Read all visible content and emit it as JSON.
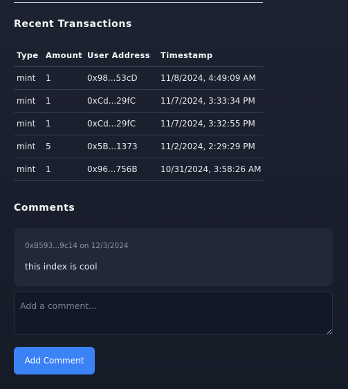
{
  "transactions": {
    "title": "Recent Transactions",
    "columns": [
      "Type",
      "Amount",
      "User Address",
      "Timestamp"
    ],
    "rows": [
      [
        "mint",
        "1",
        "0x98...53cD",
        "11/8/2024, 4:49:09 AM"
      ],
      [
        "mint",
        "1",
        "0xCd...29fC",
        "11/7/2024, 3:33:34 PM"
      ],
      [
        "mint",
        "1",
        "0xCd...29fC",
        "11/7/2024, 3:32:55 PM"
      ],
      [
        "mint",
        "5",
        "0x5B...1373",
        "11/2/2024, 2:29:29 PM"
      ],
      [
        "mint",
        "1",
        "0x96...756B",
        "10/31/2024, 3:58:26 AM"
      ]
    ]
  },
  "comments": {
    "title": "Comments",
    "items": [
      {
        "meta": "0xB593...9c14 on 12/3/2024",
        "text": "this index is cool"
      }
    ],
    "input_placeholder": "Add a comment...",
    "add_button_label": "Add Comment"
  }
}
